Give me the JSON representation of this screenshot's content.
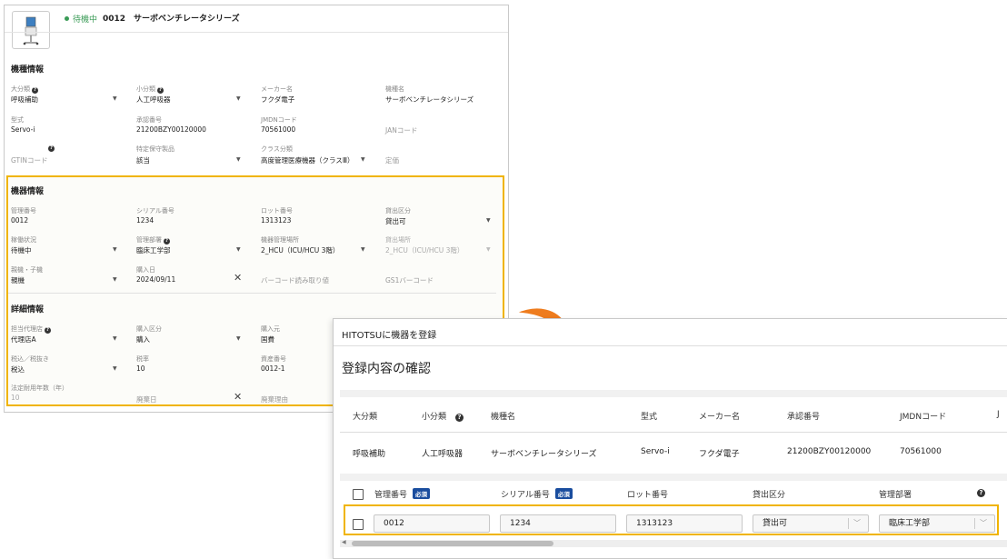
{
  "left": {
    "status": "待機中",
    "header_title": "0012　サーボベンチレータシリーズ",
    "model_section": {
      "title": "機種情報",
      "major_category_label": "大分類",
      "major_category_value": "呼吸補助",
      "minor_category_label": "小分類",
      "minor_category_value": "人工呼吸器",
      "maker_label": "メーカー名",
      "maker_value": "フクダ電子",
      "model_name_label": "機種名",
      "model_name_value": "サーボベンチレータシリーズ",
      "type_label": "型式",
      "type_value": "Servo-i",
      "approval_label": "承認番号",
      "approval_value": "21200BZY00120000",
      "jmdn_label": "JMDNコード",
      "jmdn_value": "70561000",
      "jan_placeholder": "JANコード",
      "gtin_placeholder": "GTINコード",
      "special_label": "特定保守製品",
      "special_value": "該当",
      "class_label": "クラス分類",
      "class_value": "高度管理医療機器（クラスⅢ）",
      "price_placeholder": "定価"
    },
    "device_section": {
      "title": "機器情報",
      "mgmt_label": "管理番号",
      "mgmt_value": "0012",
      "serial_label": "シリアル番号",
      "serial_value": "1234",
      "lot_label": "ロット番号",
      "lot_value": "1313123",
      "lend_label": "貸出区分",
      "lend_value": "貸出可",
      "operation_label": "稼働状況",
      "operation_value": "待機中",
      "dept_label": "管理部署",
      "dept_value": "臨床工学部",
      "location_label": "機器管理場所",
      "location_value": "2_HCU（ICU/HCU 3階）",
      "lend_place_label": "貸出場所",
      "lend_place_value": "2_HCU（ICU/HCU 3階）",
      "parent_label": "親機・子機",
      "parent_value": "親機",
      "purchase_date_label": "購入日",
      "purchase_date_value": "2024/09/11",
      "barcode_placeholder": "バーコード読み取り値",
      "gs1_placeholder": "GS1バーコード"
    },
    "detail_section": {
      "title": "詳細情報",
      "agent_label": "担当代理店",
      "agent_value": "代理店A",
      "purchase_type_label": "購入区分",
      "purchase_type_value": "購入",
      "source_label": "購入元",
      "source_value": "国費",
      "tax_label": "税込／税抜き",
      "tax_value": "税込",
      "tax_rate_label": "税率",
      "tax_rate_value": "10",
      "asset_label": "資産番号",
      "asset_value": "0012-1",
      "life_label": "法定耐用年数（年）",
      "life_value": "10",
      "disposal_date_placeholder": "廃棄日",
      "disposal_reason_placeholder": "廃棄理由"
    }
  },
  "right": {
    "dialog_title": "HITOTSUに機器を登録",
    "confirm_title": "登録内容の確認",
    "table1": {
      "headers": [
        "大分類",
        "小分類",
        "機種名",
        "型式",
        "メーカー名",
        "承認番号",
        "JMDNコード",
        "J"
      ],
      "row": [
        "呼吸補助",
        "人工呼吸器",
        "サーボベンチレータシリーズ",
        "Servo-i",
        "フクダ電子",
        "21200BZY00120000",
        "70561000"
      ]
    },
    "table2": {
      "headers": [
        "管理番号",
        "シリアル番号",
        "ロット番号",
        "貸出区分",
        "管理部署"
      ],
      "required_badge": "必須",
      "row": {
        "mgmt": "0012",
        "serial": "1234",
        "lot": "1313123",
        "lend": "貸出可",
        "dept": "臨床工学部"
      }
    }
  },
  "colors": {
    "highlight": "#f0b400",
    "arrow": "#ee7c1e",
    "status_green": "#3a9b56",
    "required_blue": "#1a4d9e"
  }
}
